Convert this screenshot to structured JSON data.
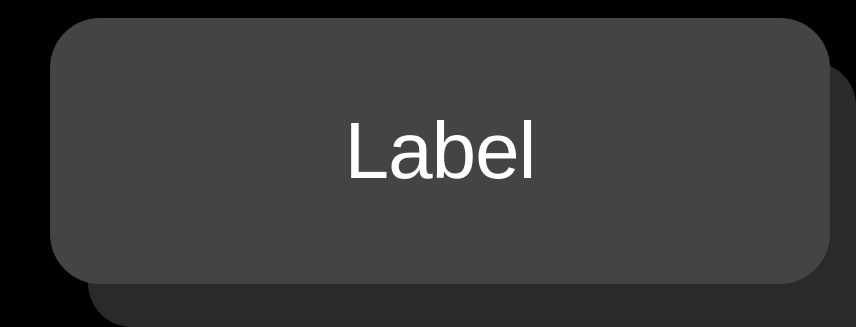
{
  "button": {
    "label": "Label",
    "background_color": "#444444",
    "shadow_color": "#2a2a2a",
    "text_color": "#ffffff"
  },
  "page": {
    "background_color": "#000000"
  }
}
